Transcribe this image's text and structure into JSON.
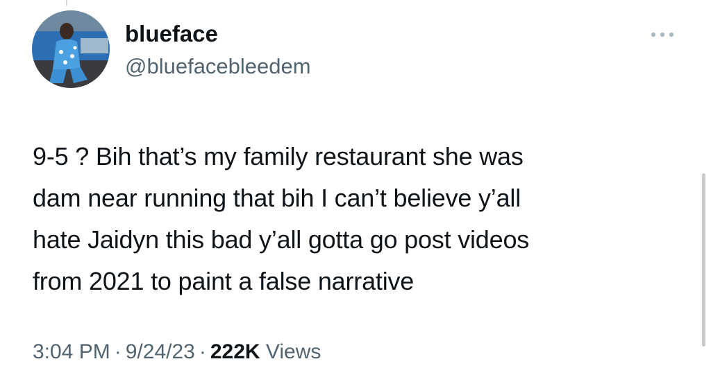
{
  "author": {
    "display_name": "blueface",
    "handle": "@bluefacebleedem"
  },
  "tweet": {
    "lines": [
      "9-5 ? Bih that’s my family restaurant she was",
      "dam near running that bih I can’t believe y’all",
      "hate Jaidyn this bad y’all gotta go post videos",
      "from 2021 to paint a false narrative"
    ]
  },
  "meta": {
    "time": "3:04 PM",
    "date": "9/24/23",
    "views_count": "222K",
    "views_label": "Views"
  },
  "icons": {
    "more": "more-horizontal-icon"
  },
  "colors": {
    "text_primary": "#0f1419",
    "text_secondary": "#536471"
  }
}
